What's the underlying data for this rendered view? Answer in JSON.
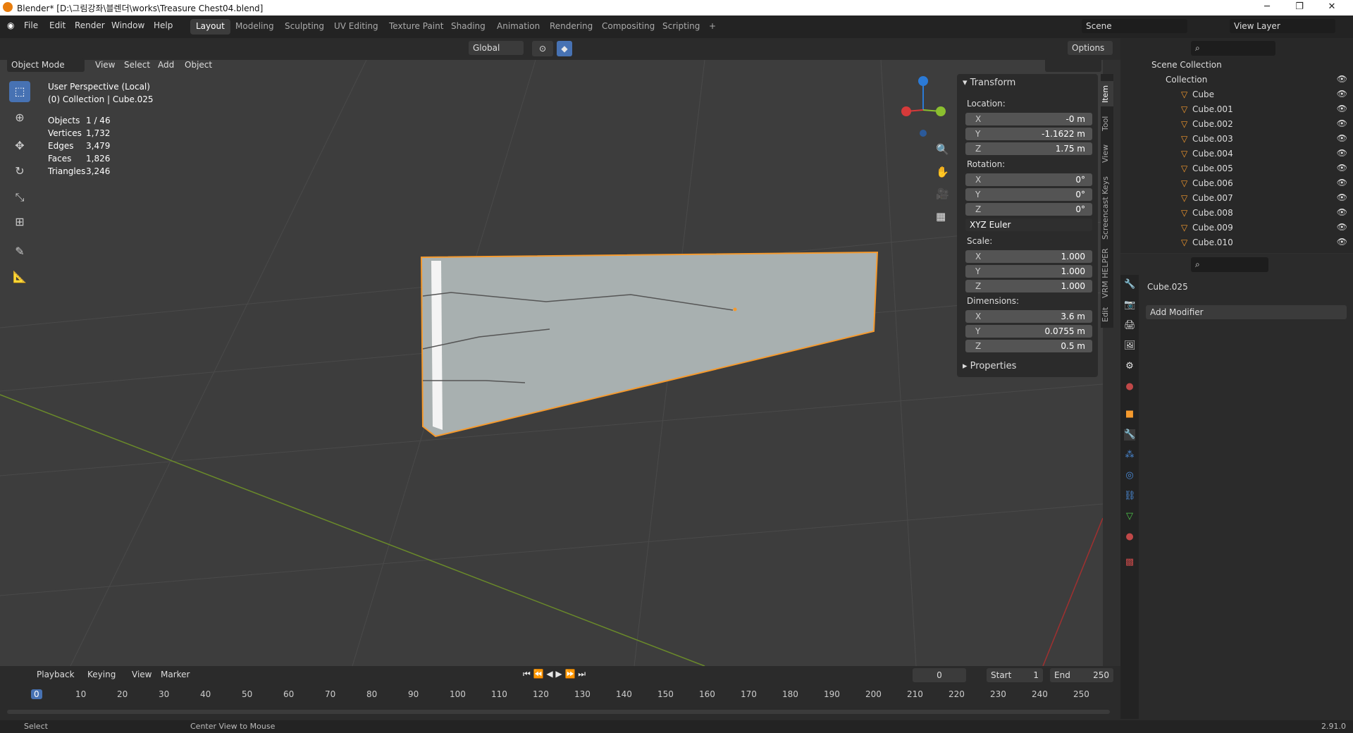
{
  "title": "Blender* [D:\\그림강좌\\블렌더\\works\\Treasure Chest04.blend]",
  "menu": [
    "File",
    "Edit",
    "Render",
    "Window",
    "Help"
  ],
  "workspaces": [
    "Layout",
    "Modeling",
    "Sculpting",
    "UV Editing",
    "Texture Paint",
    "Shading",
    "Animation",
    "Rendering",
    "Compositing",
    "Scripting"
  ],
  "scene": "Scene",
  "view_layer": "View Layer",
  "transform_orientation": "Global",
  "options": "Options",
  "mode": "Object Mode",
  "vp_menu": [
    "View",
    "Select",
    "Add",
    "Object"
  ],
  "viewport_info": {
    "line1": "User Perspective (Local)",
    "line2": "(0) Collection | Cube.025"
  },
  "stats": [
    {
      "label": "Objects",
      "value": "1 / 46"
    },
    {
      "label": "Vertices",
      "value": "1,732"
    },
    {
      "label": "Edges",
      "value": "3,479"
    },
    {
      "label": "Faces",
      "value": "1,826"
    },
    {
      "label": "Triangles",
      "value": "3,246"
    }
  ],
  "npanel": {
    "header": "Transform",
    "location_label": "Location:",
    "location": [
      "-0 m",
      "-1.1622 m",
      "1.75 m"
    ],
    "rotation_label": "Rotation:",
    "rotation": [
      "0°",
      "0°",
      "0°"
    ],
    "rotation_mode": "XYZ Euler",
    "scale_label": "Scale:",
    "scale": [
      "1.000",
      "1.000",
      "1.000"
    ],
    "dimensions_label": "Dimensions:",
    "dimensions": [
      "3.6 m",
      "0.0755 m",
      "0.5 m"
    ],
    "axes": [
      "X",
      "Y",
      "Z"
    ],
    "properties": "Properties"
  },
  "side_tabs": [
    "Item",
    "Tool",
    "View",
    "Screencast Keys",
    "VRM HELPER",
    "Edit"
  ],
  "outliner": {
    "scene_collection": "Scene Collection",
    "collection": "Collection",
    "items": [
      "Cube",
      "Cube.001",
      "Cube.002",
      "Cube.003",
      "Cube.004",
      "Cube.005",
      "Cube.006",
      "Cube.007",
      "Cube.008",
      "Cube.009",
      "Cube.010"
    ]
  },
  "props": {
    "object": "Cube.025",
    "add_modifier": "Add Modifier"
  },
  "timeline": {
    "menu": [
      "Playback",
      "Keying",
      "View",
      "Marker"
    ],
    "current": "0",
    "start_label": "Start",
    "start": "1",
    "end_label": "End",
    "end": "250",
    "ticks": [
      "0",
      "10",
      "20",
      "30",
      "40",
      "50",
      "60",
      "70",
      "80",
      "90",
      "100",
      "110",
      "120",
      "130",
      "140",
      "150",
      "160",
      "170",
      "180",
      "190",
      "200",
      "210",
      "220",
      "230",
      "240",
      "250"
    ]
  },
  "status": {
    "left": "Select",
    "middle": "Center View to Mouse",
    "version": "2.91.0"
  },
  "colors": {
    "accent": "#4772b3",
    "selection": "#f59a2e",
    "background": "#3d3d3d"
  }
}
